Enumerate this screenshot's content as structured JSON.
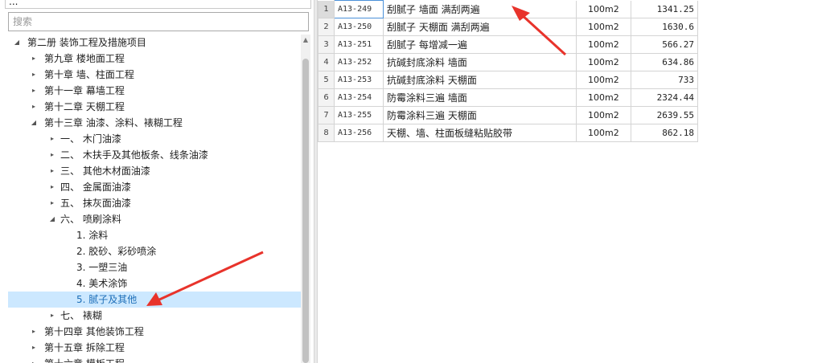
{
  "top_title": "...",
  "search": {
    "placeholder": "搜索"
  },
  "tree": [
    {
      "label": "第二册 装饰工程及措施项目",
      "expander": "expanded",
      "selected": false
    },
    {
      "label": "第九章 楼地面工程",
      "expander": "collapsed",
      "selected": false
    },
    {
      "label": "第十章 墙、柱面工程",
      "expander": "collapsed",
      "selected": false
    },
    {
      "label": "第十一章 幕墙工程",
      "expander": "collapsed",
      "selected": false
    },
    {
      "label": "第十二章 天棚工程",
      "expander": "collapsed",
      "selected": false
    },
    {
      "label": "第十三章 油漆、涂料、裱糊工程",
      "expander": "expanded",
      "selected": false
    },
    {
      "label": "一、 木门油漆",
      "expander": "collapsed",
      "selected": false
    },
    {
      "label": "二、 木扶手及其他板条、线条油漆",
      "expander": "collapsed",
      "selected": false
    },
    {
      "label": "三、 其他木材面油漆",
      "expander": "collapsed",
      "selected": false
    },
    {
      "label": "四、 金属面油漆",
      "expander": "collapsed",
      "selected": false
    },
    {
      "label": "五、 抹灰面油漆",
      "expander": "collapsed",
      "selected": false
    },
    {
      "label": "六、 喷刷涂料",
      "expander": "expanded",
      "selected": false
    },
    {
      "label": "1. 涂料",
      "expander": "none",
      "selected": false
    },
    {
      "label": "2. 胶砂、彩砂喷涂",
      "expander": "none",
      "selected": false
    },
    {
      "label": "3. 一塑三油",
      "expander": "none",
      "selected": false
    },
    {
      "label": "4. 美术涂饰",
      "expander": "none",
      "selected": false
    },
    {
      "label": "5. 腻子及其他",
      "expander": "none",
      "selected": true
    },
    {
      "label": "七、 裱糊",
      "expander": "collapsed",
      "selected": false
    },
    {
      "label": "第十四章 其他装饰工程",
      "expander": "collapsed",
      "selected": false
    },
    {
      "label": "第十五章 拆除工程",
      "expander": "collapsed",
      "selected": false
    },
    {
      "label": "第十六章 模板工程",
      "expander": "collapsed",
      "selected": false
    }
  ],
  "grid": {
    "rows": [
      {
        "num": "1",
        "code": "A13-249",
        "name": "刮腻子 墙面 满刮两遍",
        "unit": "100m2",
        "amount": "1341.25"
      },
      {
        "num": "2",
        "code": "A13-250",
        "name": "刮腻子 天棚面 满刮两遍",
        "unit": "100m2",
        "amount": "1630.6"
      },
      {
        "num": "3",
        "code": "A13-251",
        "name": "刮腻子 每增减一遍",
        "unit": "100m2",
        "amount": "566.27"
      },
      {
        "num": "4",
        "code": "A13-252",
        "name": "抗碱封底涂料 墙面",
        "unit": "100m2",
        "amount": "634.86"
      },
      {
        "num": "5",
        "code": "A13-253",
        "name": "抗碱封底涂料 天棚面",
        "unit": "100m2",
        "amount": "733"
      },
      {
        "num": "6",
        "code": "A13-254",
        "name": "防霉涂料三遍 墙面",
        "unit": "100m2",
        "amount": "2324.44"
      },
      {
        "num": "7",
        "code": "A13-255",
        "name": "防霉涂料三遍 天棚面",
        "unit": "100m2",
        "amount": "2639.55"
      },
      {
        "num": "8",
        "code": "A13-256",
        "name": "天棚、墙、柱面板缝粘贴胶带",
        "unit": "100m2",
        "amount": "862.18"
      }
    ],
    "active_row": 0
  },
  "annotations": {
    "arrow_color": "#e8332b"
  },
  "icons": {
    "expanded": "triangle-down-icon",
    "collapsed": "triangle-right-icon",
    "scroll_up": "chevron-up-icon"
  }
}
